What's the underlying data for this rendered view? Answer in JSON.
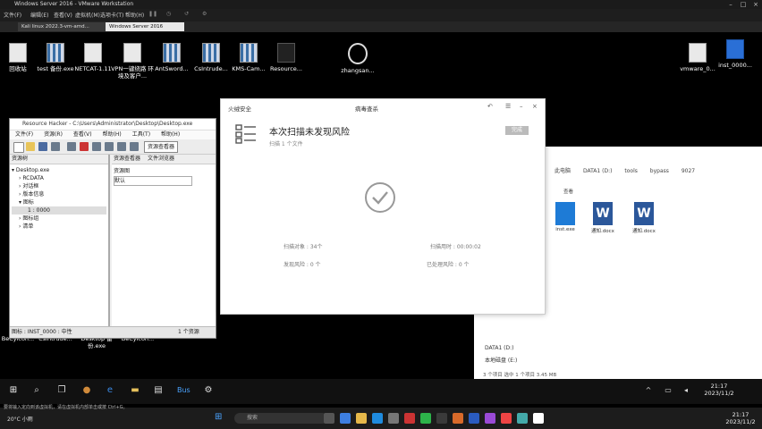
{
  "vm": {
    "title": "Windows Server 2016 - VMware Workstation",
    "menu": [
      "文件(F)",
      "编辑(E)",
      "查看(V)",
      "虚拟机(M)",
      "选项卡(T)",
      "帮助(H)"
    ],
    "tabs": [
      "Kali linux 2022.3-vm-amd...",
      "Windows Server 2016"
    ]
  },
  "desktop_icons": [
    {
      "label": "回收站"
    },
    {
      "label": "test 备份.exe"
    },
    {
      "label": "NETCAT-1.11"
    },
    {
      "label": "VPN一键绕路 环境及客户..."
    },
    {
      "label": "AntSword..."
    },
    {
      "label": "CsIntrude..."
    },
    {
      "label": "KMS-Cam..."
    },
    {
      "label": "Resource..."
    },
    {
      "label": "zhangsan..."
    },
    {
      "label": "vmware_0..."
    },
    {
      "label": "inst_0000..."
    },
    {
      "label": "BeCylcon..."
    },
    {
      "label": "CsIntrude..."
    },
    {
      "label": "Desktop 备份.exe"
    },
    {
      "label": "BeCylcon..."
    }
  ],
  "resource_hacker": {
    "title": "Resource Hacker - C:\\Users\\Administrator\\Desktop\\Desktop.exe",
    "menu": [
      "文件(F)",
      "资源(R)",
      "查看(V)",
      "帮助(H)",
      "工具(T)",
      "帮助(H)"
    ],
    "toolbar_label": "资源查看器",
    "left_header": "资源树",
    "right_tabs": [
      "资源查看器",
      "文件浏览器"
    ],
    "right_title": "资源图",
    "right_value": "默认",
    "tree": [
      "Desktop.exe",
      "RCDATA",
      "对话框",
      "版本信息",
      "图标",
      "1 : 0000",
      "图标组",
      "清单"
    ],
    "status_left": "图标 : INST_0000 : 中性",
    "status_mid": "1 个资源"
  },
  "antivirus": {
    "brand": "火绒安全",
    "header_title": "病毒查杀",
    "result_title": "本次扫描未发现风险",
    "result_sub": "扫描 1 个文件",
    "button": "完成",
    "stats": {
      "scanned_label": "扫描对象 : 34个",
      "time_label": "扫描用时 : 00:00:02",
      "found_label": "发现风险 : 0 个",
      "handled_label": "已处理风险 : 0 个"
    }
  },
  "file_explorer": {
    "breadcrumb": [
      "此电脑",
      "DATA1 (D:)",
      "tools",
      "bypass",
      "9027"
    ],
    "sort_label": "查看",
    "files": [
      {
        "label": "inst.exe"
      },
      {
        "label": "通知.docx"
      },
      {
        "label": "通知.docx"
      }
    ],
    "tree": [
      "DATA1 (D:)",
      "本地磁盘 (E:)"
    ],
    "status": "3 个项目   选中 1 个项目  3.45 MB"
  },
  "guest_clock": {
    "time": "21:17",
    "date": "2023/11/2"
  },
  "host_taskbar": {
    "weather": "20°C 小雨",
    "search_placeholder": "搜索",
    "clock_time": "21:17",
    "clock_date": "2023/11/2",
    "notice": "要将输入定向到该虚拟机，请在虚拟机内部单击或按 Ctrl+G。"
  }
}
